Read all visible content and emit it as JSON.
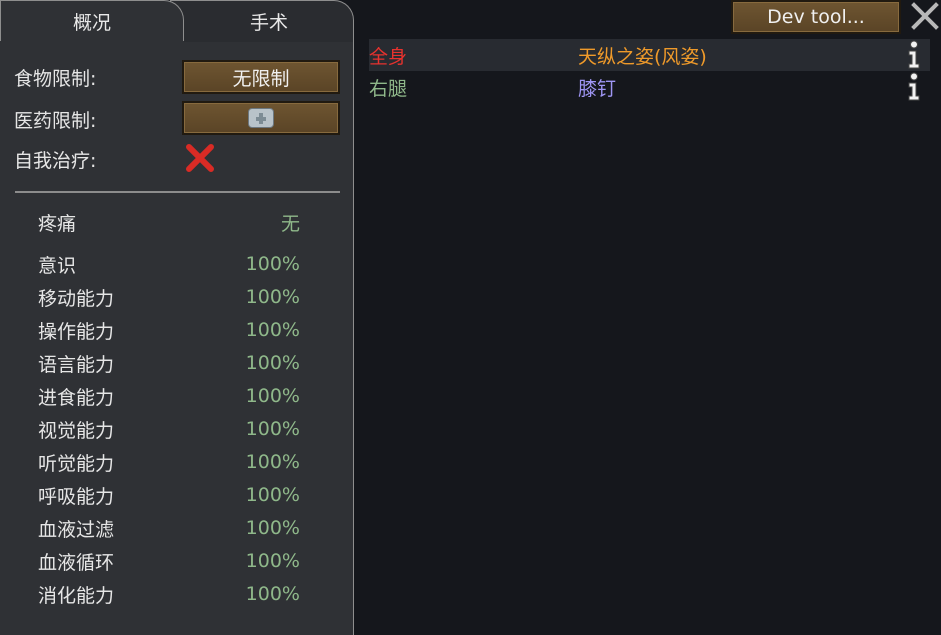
{
  "tabs": {
    "overview": "概况",
    "operations": "手术"
  },
  "settings": {
    "food_label": "食物限制:",
    "food_value": "无限制",
    "medicine_label": "医药限制:",
    "self_tend_label": "自我治疗:"
  },
  "pain": {
    "label": "疼痛",
    "value": "无"
  },
  "capacities": [
    {
      "label": "意识",
      "value": "100%"
    },
    {
      "label": "移动能力",
      "value": "100%"
    },
    {
      "label": "操作能力",
      "value": "100%"
    },
    {
      "label": "语言能力",
      "value": "100%"
    },
    {
      "label": "进食能力",
      "value": "100%"
    },
    {
      "label": "视觉能力",
      "value": "100%"
    },
    {
      "label": "听觉能力",
      "value": "100%"
    },
    {
      "label": "呼吸能力",
      "value": "100%"
    },
    {
      "label": "血液过滤",
      "value": "100%"
    },
    {
      "label": "血液循环",
      "value": "100%"
    },
    {
      "label": "消化能力",
      "value": "100%"
    }
  ],
  "dev_tool_label": "Dev tool...",
  "hediffs": [
    {
      "part": "全身",
      "name": "天纵之姿(风姿)",
      "part_color": "#e8322e",
      "name_color": "#ef9a2a"
    },
    {
      "part": "右腿",
      "name": "膝钉",
      "part_color": "#8fb88a",
      "name_color": "#9f96f4"
    }
  ],
  "icons": {
    "medicine": "medkit-icon",
    "self_tend": "red-x-icon",
    "close": "close-icon",
    "info": "info-icon"
  }
}
